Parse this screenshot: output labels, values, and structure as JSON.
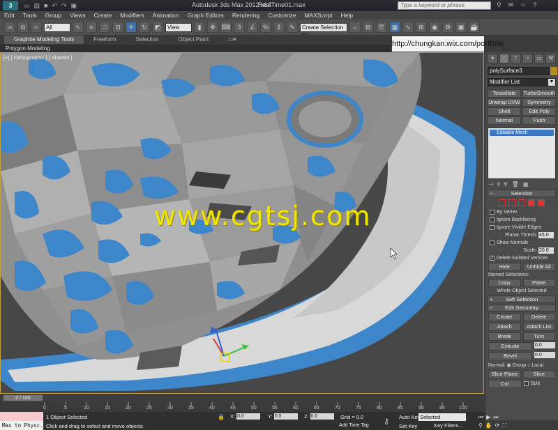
{
  "titlebar": {
    "app_title": "Autodesk 3ds Max  2012 x64",
    "file_name": "RealTime01.max",
    "search_placeholder": "Type a keyword or phrase"
  },
  "menu": [
    "Edit",
    "Tools",
    "Group",
    "Views",
    "Create",
    "Modifiers",
    "Animation",
    "Graph Editors",
    "Rendering",
    "Customize",
    "MAXScript",
    "Help"
  ],
  "toolbar": {
    "filter_value": "All",
    "view_value": "View",
    "selection_set": "Create Selection Se"
  },
  "ribbon": {
    "tabs": [
      "Graphite Modeling Tools",
      "Freeform",
      "Selection",
      "Object Paint"
    ],
    "sub_label": "Polygon Modeling"
  },
  "banner": {
    "url": "http://chungkan.wix.com/portfolio"
  },
  "viewport": {
    "label": "[+] [ Orthographic ] [ Shaded ]",
    "watermark": "www.cgtsj.com"
  },
  "panel": {
    "object_name": "polySurface3",
    "modifier_list": "Modifier List",
    "modifier_buttons": [
      "Tessellate",
      "TurboSmooth",
      "Unwrap UVW",
      "Symmetry",
      "Shell",
      "Edit Poly",
      "Normal",
      "Push"
    ],
    "stack_item": "Editable Mesh",
    "selection": {
      "title": "Selection",
      "by_vertex": "By Vertex",
      "ignore_backfacing": "Ignore Backfacing",
      "ignore_visible_edges": "Ignore Visible Edges",
      "planar_thresh_label": "Planar Thresh:",
      "planar_thresh_value": "45.0",
      "show_normals": "Show Normals",
      "scale_label": "Scale:",
      "scale_value": "20.0",
      "delete_isolated": "Delete Isolated Vertices",
      "hide": "Hide",
      "unhide_all": "Unhide All",
      "named_selections": "Named Selections:",
      "copy": "Copy",
      "paste": "Paste",
      "whole_object": "Whole Object Selected"
    },
    "soft_selection": "Soft Selection",
    "edit_geometry": {
      "title": "Edit Geometry",
      "create": "Create",
      "delete": "Delete",
      "attach": "Attach",
      "attach_list": "Attach List",
      "break": "Break",
      "turn": "Turn",
      "extrude": "Extrude",
      "extrude_value": "0.0",
      "bevel": "Bevel",
      "bevel_value": "0.0",
      "normal_label": "Normal:",
      "group": "Group",
      "local": "Local",
      "slice_plane": "Slice Plane",
      "slice": "Slice",
      "cut": "Cut",
      "split": "Split"
    }
  },
  "timeline": {
    "thumb": "0 / 100",
    "ticks": [
      "0",
      "5",
      "10",
      "15",
      "20",
      "25",
      "30",
      "35",
      "40",
      "45",
      "50",
      "55",
      "60",
      "65",
      "70",
      "75",
      "80",
      "85",
      "90",
      "95",
      "100"
    ]
  },
  "status": {
    "maxscript": "Max to Physc.",
    "objects_selected": "1 Object Selected",
    "prompt": "Click and drag to select and move objects",
    "x_label": "X:",
    "x_value": "0.0",
    "y_label": "Y:",
    "y_value": "0.0",
    "z_label": "Z:",
    "z_value": "0.0",
    "grid": "Grid = 0.0",
    "add_time_tag": "Add Time Tag",
    "auto_key": "Auto Key",
    "set_key": "Set Key",
    "selected": "Selected",
    "key_filters": "Key Filters..."
  }
}
